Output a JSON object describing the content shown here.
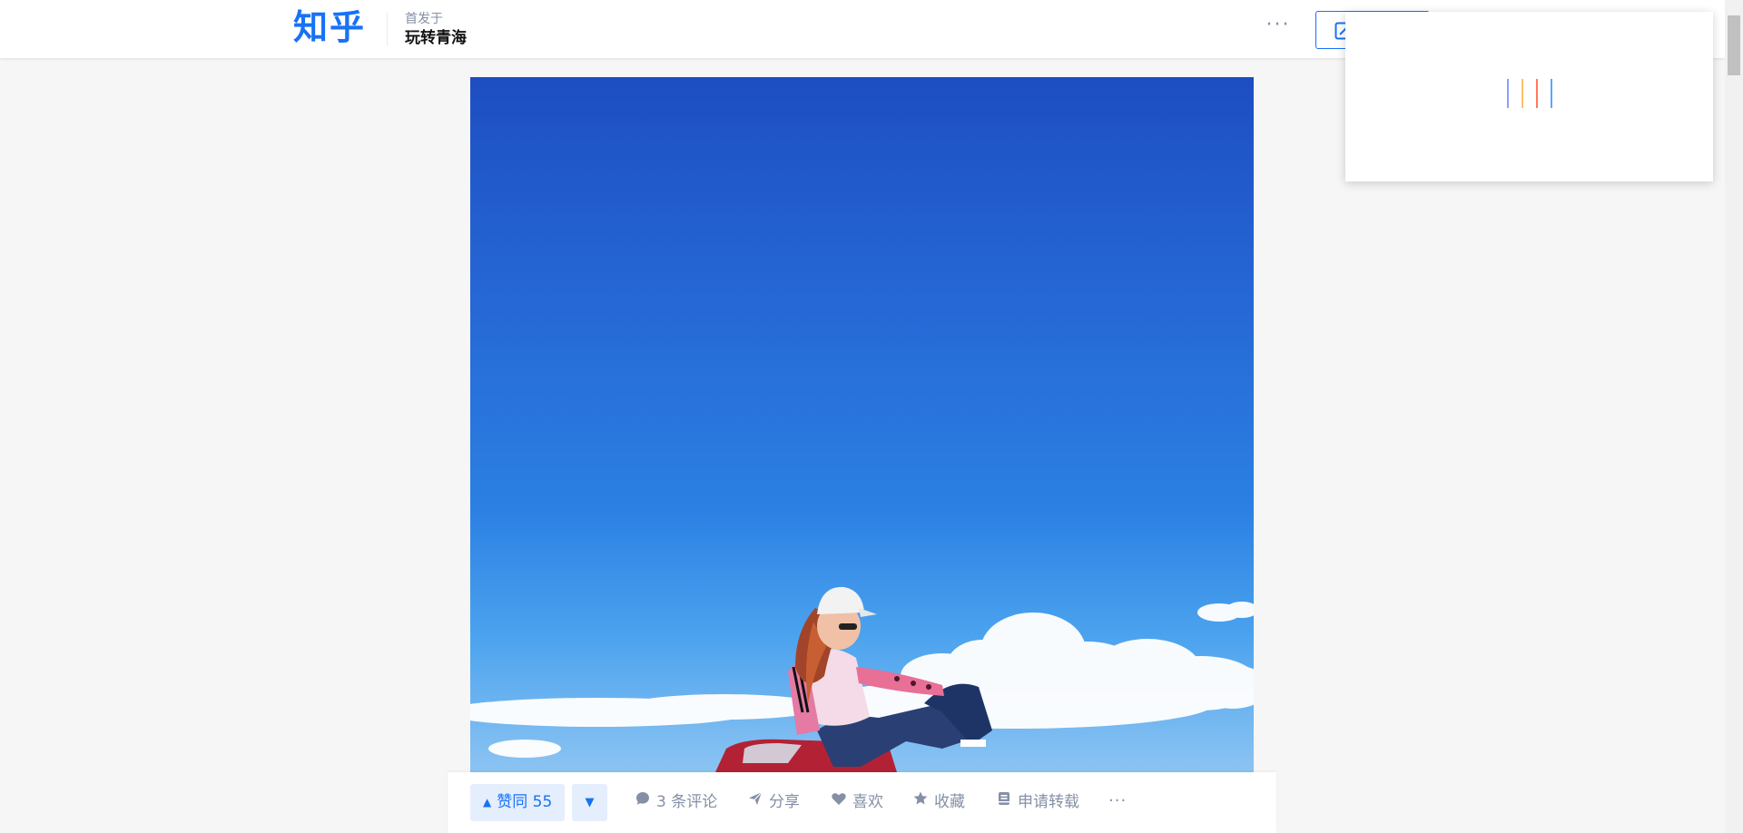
{
  "header": {
    "logo": "知乎",
    "column_pre": "首发于",
    "column_name": "玩转青海",
    "more_label": "···"
  },
  "popup": {
    "loading_bar_colors": [
      "#8c9eff",
      "#ffc266",
      "#ff7a59",
      "#57a6ff"
    ]
  },
  "actions": {
    "vote_up_label": "赞同 55",
    "vote_down_label": "▼",
    "comment_label": "3 条评论",
    "share_label": "分享",
    "like_label": "喜欢",
    "collect_label": "收藏",
    "repost_label": "申请转载",
    "more_label": "···"
  },
  "icons": {
    "write": "pen-icon",
    "comment": "comment-icon",
    "share": "share-icon",
    "like": "heart-icon",
    "collect": "star-icon",
    "repost": "repost-icon"
  },
  "colors": {
    "brand": "#1772f6",
    "muted": "#8590a6",
    "vote_bg": "#e5eefd"
  }
}
